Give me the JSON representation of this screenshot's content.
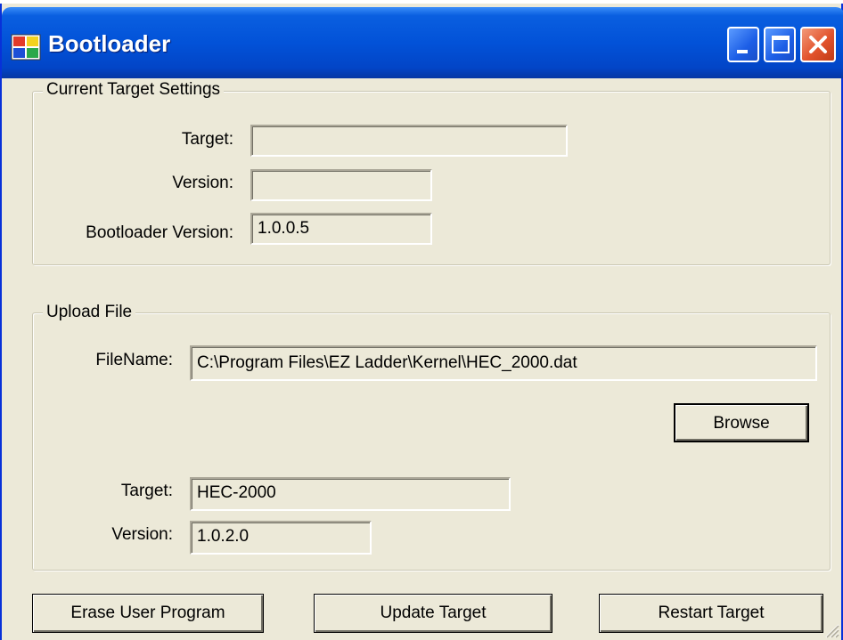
{
  "window": {
    "title": "Bootloader"
  },
  "current_target": {
    "legend": "Current Target Settings",
    "target_label": "Target:",
    "target_value": "",
    "version_label": "Version:",
    "version_value": "",
    "bootloader_label": "Bootloader Version:",
    "bootloader_value": "1.0.0.5"
  },
  "upload": {
    "legend": "Upload File",
    "filename_label": "FileName:",
    "filename_value": "C:\\Program Files\\EZ Ladder\\Kernel\\HEC_2000.dat",
    "browse_label": "Browse",
    "target_label": "Target:",
    "target_value": "HEC-2000",
    "version_label": "Version:",
    "version_value": "1.0.2.0"
  },
  "actions": {
    "erase_label": "Erase User Program",
    "update_label": "Update Target",
    "restart_label": "Restart Target"
  },
  "colors": {
    "titlebar": "#0252d8",
    "window_bg": "#ece9d8",
    "close_button": "#e2532d"
  }
}
